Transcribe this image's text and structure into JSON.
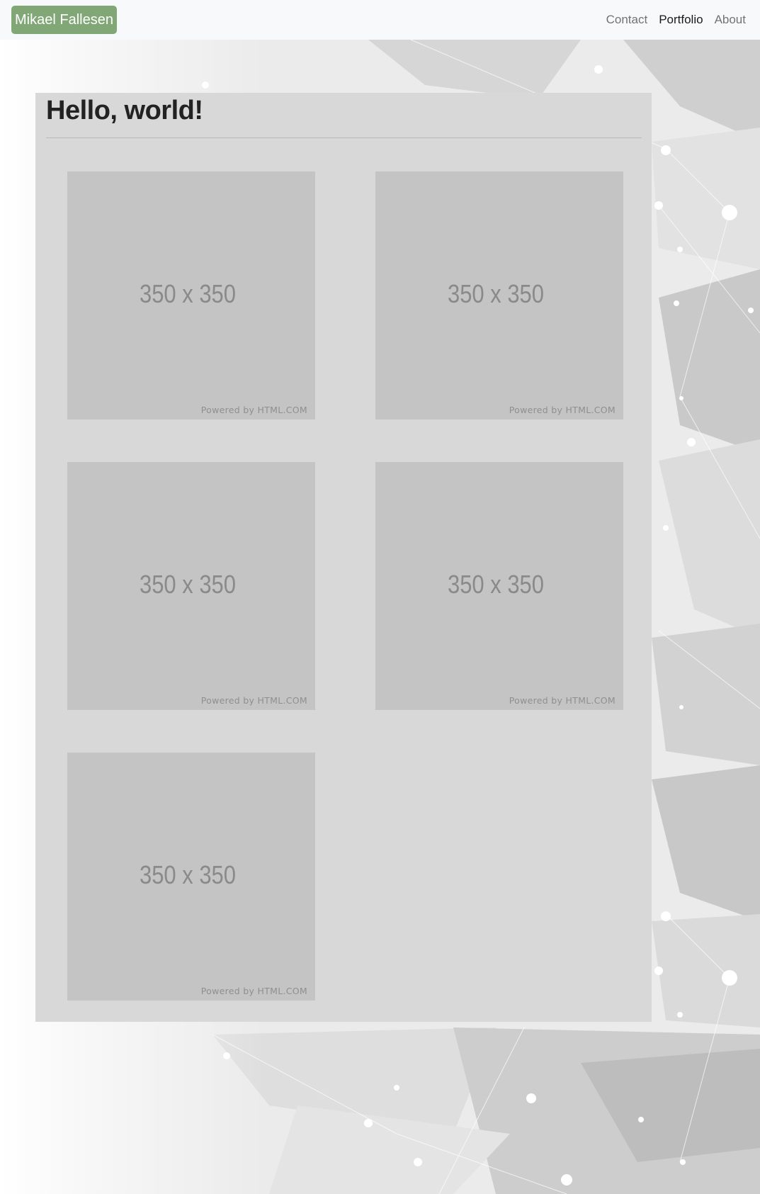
{
  "navbar": {
    "brand": "Mikael Fallesen",
    "links": [
      {
        "label": "Contact",
        "active": false
      },
      {
        "label": "Portfolio",
        "active": true
      },
      {
        "label": "About",
        "active": false
      }
    ]
  },
  "main": {
    "heading": "Hello, world!",
    "thumbnails": [
      {
        "size_label": "350 x 350",
        "credit": "Powered by HTML.COM"
      },
      {
        "size_label": "350 x 350",
        "credit": "Powered by HTML.COM"
      },
      {
        "size_label": "350 x 350",
        "credit": "Powered by HTML.COM"
      },
      {
        "size_label": "350 x 350",
        "credit": "Powered by HTML.COM"
      },
      {
        "size_label": "350 x 350",
        "credit": "Powered by HTML.COM"
      }
    ]
  },
  "colors": {
    "brand_bg": "#82a777",
    "navbar_bg": "#f8f9fa",
    "panel_bg": "#d8d8d8",
    "placeholder_bg": "#c4c4c4"
  }
}
